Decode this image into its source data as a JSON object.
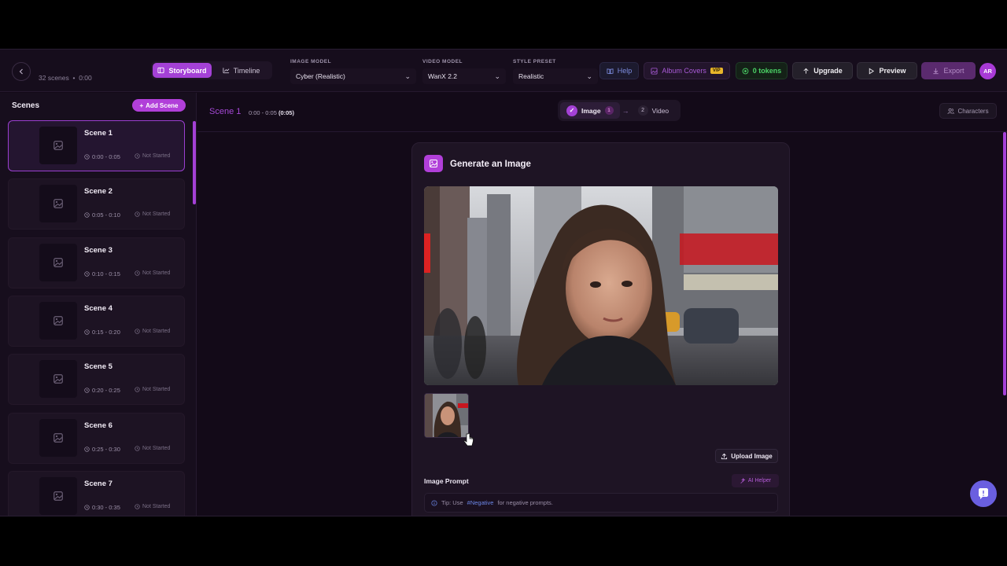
{
  "header": {
    "scene_count": "32 scenes",
    "duration": "0:00",
    "view_tabs": [
      {
        "label": "Storyboard",
        "active": true
      },
      {
        "label": "Timeline",
        "active": false
      }
    ],
    "image_model": {
      "label": "IMAGE MODEL",
      "value": "Cyber (Realistic)"
    },
    "video_model": {
      "label": "VIDEO MODEL",
      "value": "WanX 2.2"
    },
    "style_preset": {
      "label": "STYLE PRESET",
      "value": "Realistic"
    },
    "help_label": "Help",
    "album_label": "Album Covers",
    "vip_badge": "VIP",
    "tokens_label": "0 tokens",
    "upgrade_label": "Upgrade",
    "preview_label": "Preview",
    "export_label": "Export",
    "avatar_initials": "AR"
  },
  "sidebar": {
    "title": "Scenes",
    "add_label": "Add Scene",
    "scenes": [
      {
        "name": "Scene 1",
        "time": "0:00 - 0:05",
        "status": "Not Started"
      },
      {
        "name": "Scene 2",
        "time": "0:05 - 0:10",
        "status": "Not Started"
      },
      {
        "name": "Scene 3",
        "time": "0:10 - 0:15",
        "status": "Not Started"
      },
      {
        "name": "Scene 4",
        "time": "0:15 - 0:20",
        "status": "Not Started"
      },
      {
        "name": "Scene 5",
        "time": "0:20 - 0:25",
        "status": "Not Started"
      },
      {
        "name": "Scene 6",
        "time": "0:25 - 0:30",
        "status": "Not Started"
      },
      {
        "name": "Scene 7",
        "time": "0:30 - 0:35",
        "status": "Not Started"
      }
    ]
  },
  "main": {
    "scene_title": "Scene 1",
    "scene_range": "0:00 - 0:05",
    "scene_duration": "(0:05)",
    "steps": {
      "image_label": "Image",
      "image_badge": "1",
      "video_num": "2",
      "video_label": "Video"
    },
    "characters_label": "Characters"
  },
  "generate": {
    "title": "Generate an Image",
    "upload_label": "Upload Image",
    "prompt_label": "Image Prompt",
    "ai_helper_label": "AI Helper",
    "tip_prefix": "Tip: Use",
    "tip_keyword": "#Negative",
    "tip_suffix": "for negative prompts."
  },
  "colors": {
    "accent": "#a441d6",
    "background": "#130a18",
    "tokens_green": "#4bd266"
  }
}
